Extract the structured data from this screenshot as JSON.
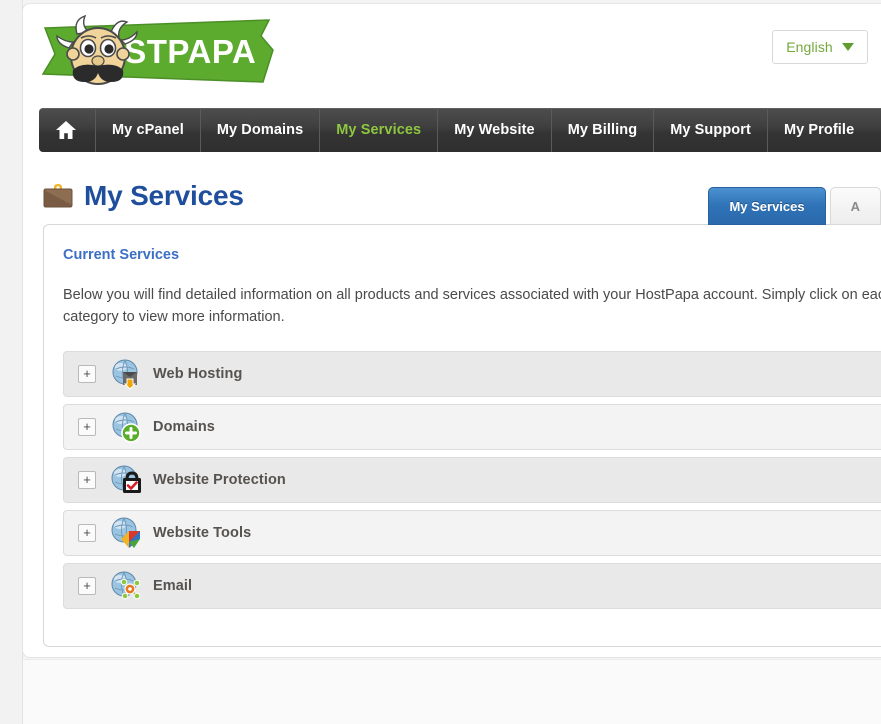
{
  "header": {
    "logo_text": "HOSTPAPA",
    "logo_alt": "hostpapa-mascot-logo",
    "language": {
      "label": "English",
      "caret_icon": "chevron-down-icon"
    }
  },
  "nav": {
    "home_icon": "home-icon",
    "items": [
      {
        "label": "My cPanel",
        "active": false
      },
      {
        "label": "My Domains",
        "active": false
      },
      {
        "label": "My Services",
        "active": true
      },
      {
        "label": "My Website",
        "active": false
      },
      {
        "label": "My Billing",
        "active": false
      },
      {
        "label": "My Support",
        "active": false
      },
      {
        "label": "My Profile",
        "active": false
      }
    ],
    "active_color": "#8dc63f"
  },
  "page": {
    "title": "My Services",
    "title_icon": "briefcase-icon",
    "title_color": "#1f4e9c"
  },
  "tabs": [
    {
      "label": "My Services",
      "active": true
    },
    {
      "label": "A",
      "active": false
    }
  ],
  "panel": {
    "heading": "Current Services",
    "description": "Below you will find detailed information on all products and services associated with your HostPapa account. Simply click on each category to view more information."
  },
  "services": [
    {
      "label": "Web Hosting",
      "icon": "globe-hosting-icon",
      "expander": "+"
    },
    {
      "label": "Domains",
      "icon": "globe-add-icon",
      "expander": "+"
    },
    {
      "label": "Website Protection",
      "icon": "globe-lock-check-icon",
      "expander": "+"
    },
    {
      "label": "Website Tools",
      "icon": "globe-tools-icon",
      "expander": "+"
    },
    {
      "label": "Email",
      "icon": "globe-network-icon",
      "expander": "+"
    }
  ]
}
